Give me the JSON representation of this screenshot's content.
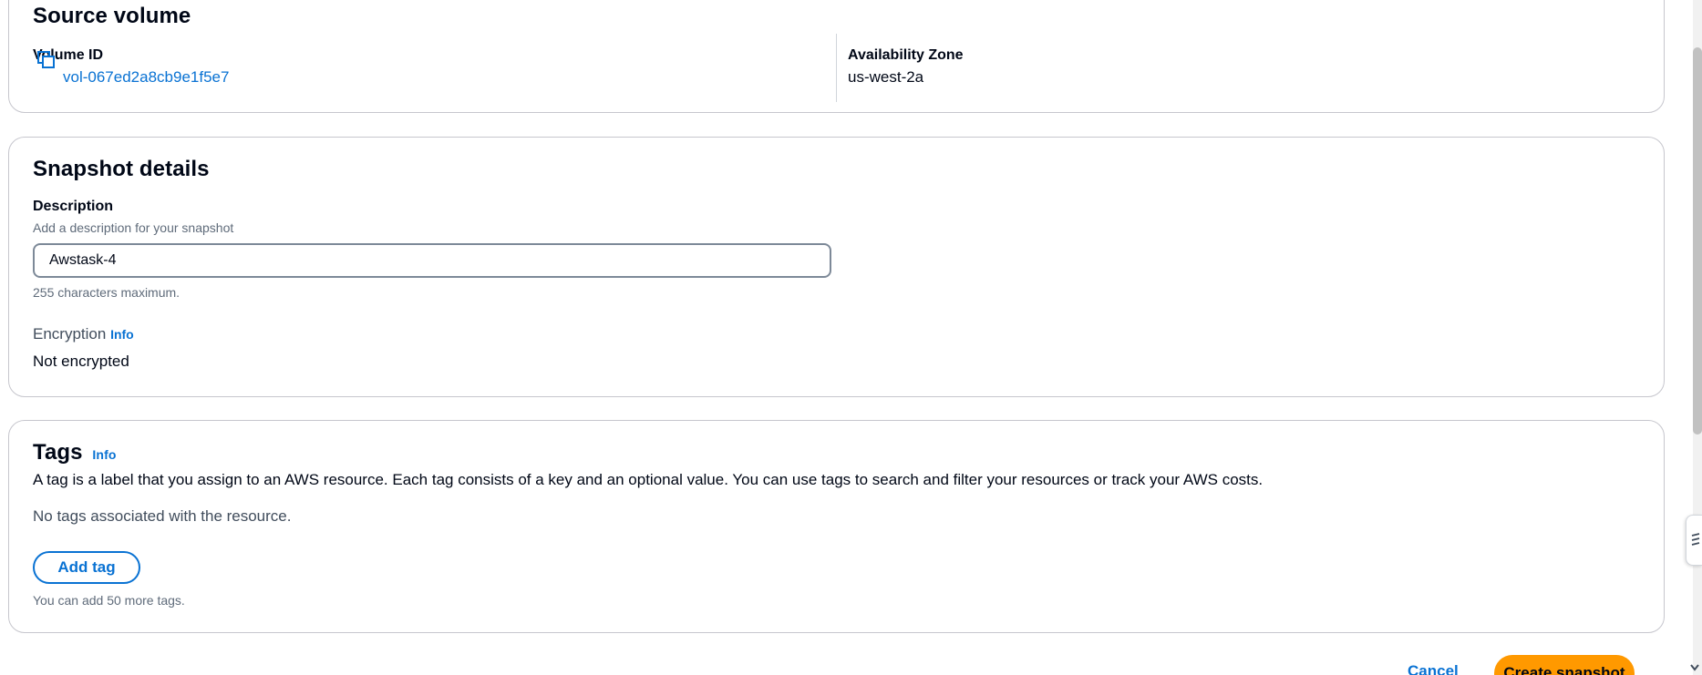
{
  "source_volume": {
    "title": "Source volume",
    "volume_id_label": "Volume ID",
    "volume_id_value": "vol-067ed2a8cb9e1f5e7",
    "az_label": "Availability Zone",
    "az_value": "us-west-2a"
  },
  "snapshot_details": {
    "title": "Snapshot details",
    "description_label": "Description",
    "description_hint": "Add a description for your snapshot",
    "description_value": "Awstask-4",
    "description_constraint": "255 characters maximum.",
    "encryption_label": "Encryption",
    "encryption_info": "Info",
    "encryption_value": "Not encrypted"
  },
  "tags": {
    "title": "Tags",
    "info": "Info",
    "description": "A tag is a label that you assign to an AWS resource. Each tag consists of a key and an optional value. You can use tags to search and filter your resources or track your AWS costs.",
    "empty_text": "No tags associated with the resource.",
    "add_button": "Add tag",
    "limit_text": "You can add 50 more tags."
  },
  "footer": {
    "cancel_label": "Cancel",
    "create_label": "Create snapshot"
  },
  "colors": {
    "link": "#0972d3",
    "primary_button": "#ff9900",
    "text": "#000716",
    "border": "#c6c6cd"
  },
  "icons": {
    "copy": "copy-icon",
    "feedback": "feedback-icon",
    "scroll_down": "chevron-down-icon"
  }
}
